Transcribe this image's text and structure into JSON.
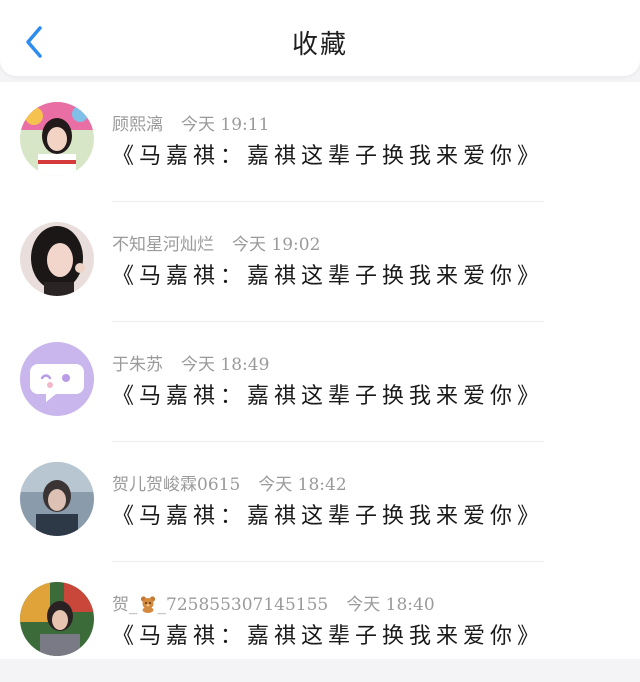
{
  "header": {
    "title": "收藏",
    "back_icon": "chevron-left-icon",
    "accent_color": "#2d8cf0"
  },
  "items": [
    {
      "name": "顾熙漓",
      "time": "今天 19:11",
      "content": "《马嘉祺：嘉祺这辈子换我来爱你》"
    },
    {
      "name": "不知星河灿烂",
      "time": "今天 19:02",
      "content": "《马嘉祺：嘉祺这辈子换我来爱你》"
    },
    {
      "name": "于朱苏",
      "time": "今天 18:49",
      "content": "《马嘉祺：嘉祺这辈子换我来爱你》"
    },
    {
      "name": "贺儿贺峻霖0615",
      "time": "今天 18:42",
      "content": "《马嘉祺：嘉祺这辈子换我来爱你》"
    },
    {
      "name": "贺_",
      "name_emoji": "bear-icon",
      "name_suffix": "_725855307145155",
      "time": "今天 18:40",
      "content": "《马嘉祺：嘉祺这辈子换我来爱你》"
    }
  ]
}
